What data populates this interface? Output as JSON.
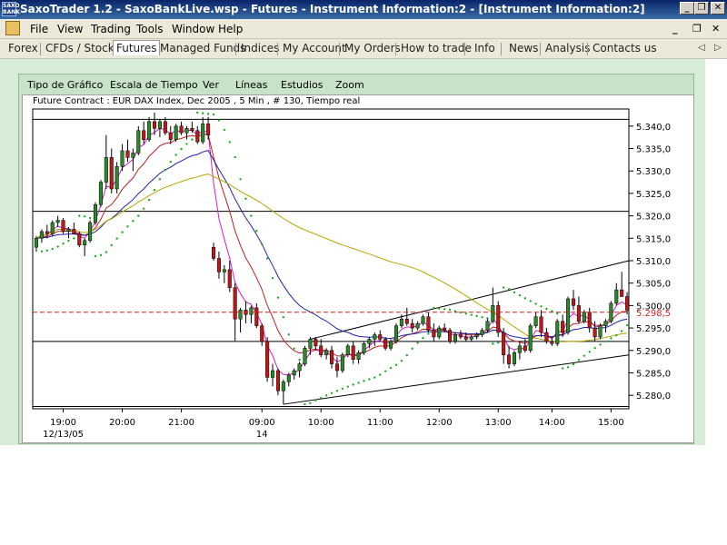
{
  "window": {
    "logo_text": "SAXO BANK",
    "title": "SaxoTrader 1.2 - SaxoBankLive.wsp - Futures - Instrument Information:2 - [Instrument Information:2]",
    "buttons": [
      "_",
      "❐",
      "✕"
    ]
  },
  "menu": {
    "items": [
      "File",
      "View",
      "Trading",
      "Tools",
      "Window",
      "Help"
    ],
    "mdi_buttons": [
      "_",
      "❐",
      "✕"
    ]
  },
  "tabs": {
    "items": [
      "Forex",
      "CFDs / Stocks",
      "Futures",
      "Managed Funds",
      "Indices",
      "My Account",
      "My Orders",
      "How to trade",
      "Info",
      "News",
      "Analysis",
      "Contacts us"
    ],
    "active": "Futures",
    "arrows": [
      "◁",
      "▷"
    ]
  },
  "toolbar": {
    "items": [
      "Tipo de Gráfico",
      "Escala de Tiempo",
      "Ver",
      "Líneas",
      "Estudios",
      "Zoom"
    ]
  },
  "chart_title": "Future Contract : EUR DAX Index, Dec 2005 , 5 Min , # 130, Tiempo real",
  "chart_data": {
    "type": "candlestick",
    "title": "Future Contract : EUR DAX Index, Dec 2005 , 5 Min , # 130, Tiempo real",
    "y_ticks": [
      "5.340,0",
      "5.335,0",
      "5.330,0",
      "5.325,0",
      "5.320,0",
      "5.315,0",
      "5.310,0",
      "5.305,0",
      "5.300,0",
      "5.295,0",
      "5.290,0",
      "5.285,0",
      "5.280,0"
    ],
    "y_range": [
      5277,
      5343
    ],
    "x_ticks": [
      {
        "label": "19:00",
        "sub": "12/13/05"
      },
      {
        "label": "20:00",
        "sub": ""
      },
      {
        "label": "21:00",
        "sub": ""
      },
      {
        "label": "09:00",
        "sub": "14"
      },
      {
        "label": "10:00",
        "sub": ""
      },
      {
        "label": "11:00",
        "sub": ""
      },
      {
        "label": "12:00",
        "sub": ""
      },
      {
        "label": "13:00",
        "sub": ""
      },
      {
        "label": "14:00",
        "sub": ""
      },
      {
        "label": "15:00",
        "sub": ""
      }
    ],
    "last_price_label": "5.298,5",
    "last_price": 5298.5,
    "horizontal_lines": [
      5341.5,
      5321.0,
      5292.0,
      5277.5
    ],
    "colors": {
      "up": "#2a8a2a",
      "down": "#c01818",
      "psar": "#22aa22",
      "ma_fast": "#cc22cc",
      "ma_mid": "#bb2222",
      "ma_slow": "#2222aa",
      "ma_long": "#b8a400",
      "last_price_line": "#cc2222"
    },
    "candles": [
      [
        5313.0,
        5315.5,
        5312.0,
        5315.0
      ],
      [
        5315.0,
        5317.0,
        5314.0,
        5316.5
      ],
      [
        5316.5,
        5318.0,
        5315.0,
        5316.0
      ],
      [
        5316.0,
        5319.0,
        5315.5,
        5318.5
      ],
      [
        5318.5,
        5320.0,
        5317.5,
        5319.0
      ],
      [
        5319.0,
        5319.5,
        5316.0,
        5316.5
      ],
      [
        5316.5,
        5317.5,
        5315.0,
        5317.0
      ],
      [
        5317.0,
        5318.5,
        5316.0,
        5316.0
      ],
      [
        5316.0,
        5316.5,
        5313.0,
        5313.5
      ],
      [
        5313.5,
        5315.0,
        5311.0,
        5314.5
      ],
      [
        5314.5,
        5319.0,
        5314.0,
        5318.5
      ],
      [
        5318.5,
        5323.0,
        5318.0,
        5322.5
      ],
      [
        5322.5,
        5328.0,
        5322.0,
        5327.5
      ],
      [
        5327.5,
        5338.0,
        5326.0,
        5333.0
      ],
      [
        5333.0,
        5335.0,
        5325.0,
        5326.0
      ],
      [
        5326.0,
        5332.0,
        5325.0,
        5331.0
      ],
      [
        5331.0,
        5336.0,
        5330.0,
        5334.5
      ],
      [
        5334.5,
        5337.0,
        5332.0,
        5333.0
      ],
      [
        5333.0,
        5335.0,
        5330.0,
        5334.0
      ],
      [
        5334.0,
        5340.0,
        5333.5,
        5339.0
      ],
      [
        5339.0,
        5341.0,
        5336.0,
        5337.0
      ],
      [
        5337.0,
        5342.0,
        5336.5,
        5341.0
      ],
      [
        5341.0,
        5343.0,
        5338.0,
        5339.5
      ],
      [
        5339.5,
        5341.5,
        5337.5,
        5341.0
      ],
      [
        5341.0,
        5342.0,
        5338.0,
        5338.5
      ],
      [
        5338.5,
        5340.0,
        5336.0,
        5337.0
      ],
      [
        5337.0,
        5340.5,
        5336.5,
        5340.0
      ],
      [
        5340.0,
        5341.0,
        5338.0,
        5338.5
      ],
      [
        5338.5,
        5340.0,
        5337.0,
        5339.5
      ],
      [
        5339.5,
        5341.0,
        5338.5,
        5339.0
      ],
      [
        5339.0,
        5340.0,
        5336.0,
        5336.5
      ],
      [
        5336.5,
        5342.0,
        5336.0,
        5340.5
      ],
      [
        5340.5,
        5342.0,
        5337.0,
        5338.0
      ],
      [
        5313.0,
        5314.0,
        5310.0,
        5310.5
      ],
      [
        5310.5,
        5312.0,
        5306.0,
        5307.5
      ],
      [
        5307.5,
        5309.0,
        5305.0,
        5308.0
      ],
      [
        5308.0,
        5310.0,
        5303.0,
        5304.0
      ],
      [
        5304.0,
        5305.0,
        5292.0,
        5297.0
      ],
      [
        5297.0,
        5299.5,
        5294.0,
        5299.0
      ],
      [
        5299.0,
        5301.0,
        5296.0,
        5298.0
      ],
      [
        5298.0,
        5300.0,
        5296.0,
        5299.5
      ],
      [
        5299.5,
        5300.5,
        5295.0,
        5295.5
      ],
      [
        5295.5,
        5296.0,
        5291.0,
        5292.0
      ],
      [
        5292.0,
        5293.0,
        5283.0,
        5284.0
      ],
      [
        5284.0,
        5287.0,
        5282.0,
        5285.5
      ],
      [
        5285.5,
        5286.0,
        5280.0,
        5281.0
      ],
      [
        5281.0,
        5283.5,
        5278.0,
        5283.0
      ],
      [
        5283.0,
        5285.0,
        5282.0,
        5284.5
      ],
      [
        5284.5,
        5286.0,
        5283.5,
        5285.5
      ],
      [
        5285.5,
        5287.5,
        5284.0,
        5287.0
      ],
      [
        5287.0,
        5291.0,
        5286.5,
        5290.5
      ],
      [
        5290.5,
        5293.0,
        5289.0,
        5292.5
      ],
      [
        5292.5,
        5293.0,
        5290.0,
        5291.0
      ],
      [
        5291.0,
        5292.5,
        5288.5,
        5289.0
      ],
      [
        5289.0,
        5290.5,
        5288.0,
        5290.0
      ],
      [
        5290.0,
        5291.0,
        5286.0,
        5287.0
      ],
      [
        5287.0,
        5288.5,
        5284.0,
        5285.5
      ],
      [
        5285.5,
        5289.5,
        5285.0,
        5289.0
      ],
      [
        5289.0,
        5291.5,
        5288.5,
        5291.0
      ],
      [
        5291.0,
        5292.0,
        5287.0,
        5288.0
      ],
      [
        5288.0,
        5290.0,
        5287.0,
        5289.5
      ],
      [
        5289.5,
        5292.0,
        5289.0,
        5291.5
      ],
      [
        5291.5,
        5293.0,
        5290.5,
        5292.5
      ],
      [
        5292.5,
        5294.0,
        5291.0,
        5293.5
      ],
      [
        5293.5,
        5294.5,
        5292.0,
        5292.5
      ],
      [
        5292.5,
        5293.0,
        5290.0,
        5290.5
      ],
      [
        5290.5,
        5292.5,
        5290.0,
        5292.0
      ],
      [
        5292.0,
        5296.0,
        5291.5,
        5295.5
      ],
      [
        5295.5,
        5298.0,
        5295.0,
        5297.0
      ],
      [
        5297.0,
        5299.5,
        5295.5,
        5296.0
      ],
      [
        5296.0,
        5297.0,
        5294.0,
        5295.0
      ],
      [
        5295.0,
        5296.5,
        5294.5,
        5296.0
      ],
      [
        5296.0,
        5298.0,
        5295.5,
        5297.5
      ],
      [
        5297.5,
        5298.5,
        5294.0,
        5294.5
      ],
      [
        5294.5,
        5296.0,
        5292.0,
        5293.0
      ],
      [
        5293.0,
        5295.5,
        5292.5,
        5295.0
      ],
      [
        5295.0,
        5296.0,
        5294.0,
        5294.5
      ],
      [
        5294.5,
        5295.0,
        5291.5,
        5292.0
      ],
      [
        5292.0,
        5294.0,
        5291.5,
        5293.5
      ],
      [
        5293.5,
        5294.5,
        5292.5,
        5293.0
      ],
      [
        5293.0,
        5294.0,
        5292.0,
        5292.5
      ],
      [
        5292.5,
        5293.5,
        5292.0,
        5293.0
      ],
      [
        5293.0,
        5294.0,
        5292.5,
        5293.5
      ],
      [
        5293.5,
        5295.0,
        5293.0,
        5294.5
      ],
      [
        5294.5,
        5297.0,
        5294.0,
        5296.5
      ],
      [
        5296.5,
        5304.0,
        5296.0,
        5300.0
      ],
      [
        5300.0,
        5301.0,
        5293.0,
        5294.0
      ],
      [
        5294.0,
        5295.0,
        5287.0,
        5289.0
      ],
      [
        5289.0,
        5291.0,
        5286.0,
        5287.0
      ],
      [
        5287.0,
        5290.0,
        5286.5,
        5289.5
      ],
      [
        5289.5,
        5292.0,
        5288.0,
        5291.0
      ],
      [
        5291.0,
        5292.5,
        5289.5,
        5290.0
      ],
      [
        5290.0,
        5296.0,
        5289.5,
        5295.5
      ],
      [
        5295.5,
        5298.5,
        5295.0,
        5297.5
      ],
      [
        5297.5,
        5299.0,
        5293.0,
        5294.0
      ],
      [
        5294.0,
        5295.0,
        5291.5,
        5292.0
      ],
      [
        5292.0,
        5293.0,
        5291.0,
        5291.5
      ],
      [
        5291.5,
        5297.0,
        5291.0,
        5296.5
      ],
      [
        5296.5,
        5298.0,
        5293.0,
        5294.0
      ],
      [
        5294.0,
        5302.0,
        5293.5,
        5301.5
      ],
      [
        5301.5,
        5303.5,
        5299.0,
        5300.0
      ],
      [
        5300.0,
        5302.0,
        5296.0,
        5296.5
      ],
      [
        5296.5,
        5299.0,
        5296.0,
        5298.5
      ],
      [
        5298.5,
        5299.5,
        5294.0,
        5295.0
      ],
      [
        5295.0,
        5296.5,
        5292.0,
        5293.0
      ],
      [
        5293.0,
        5296.0,
        5292.5,
        5295.5
      ],
      [
        5295.5,
        5297.0,
        5294.0,
        5296.5
      ],
      [
        5296.5,
        5301.0,
        5296.0,
        5300.5
      ],
      [
        5300.5,
        5305.0,
        5300.0,
        5303.5
      ],
      [
        5303.5,
        5307.5,
        5303.0,
        5302.0
      ],
      [
        5302.0,
        5303.0,
        5298.0,
        5299.0
      ]
    ]
  }
}
